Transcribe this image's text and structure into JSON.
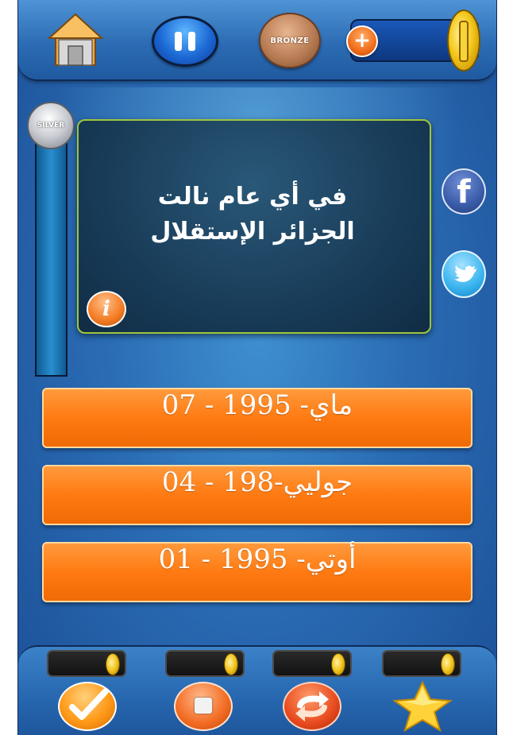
{
  "game": {
    "header": {
      "home_icon": "home-icon",
      "pause_icon": "pause-icon",
      "bronze_label": "BRONZE",
      "add_coins_symbol": "+",
      "coin_icon": "gold-coin-icon"
    },
    "progress": {
      "silver_label": "SILVER"
    },
    "question": {
      "text": "في أي عام نالت الجزائر الإستقلال",
      "info_symbol": "i"
    },
    "social": {
      "facebook_symbol": "f",
      "twitter_icon": "twitter-bird-icon"
    },
    "answers": [
      {
        "label": "ماي- 1995 - 07"
      },
      {
        "label": "جوليي-198 - 04"
      },
      {
        "label": "أوتي- 1995 - 01"
      }
    ],
    "powerups": [
      {
        "icon": "checkmark-icon"
      },
      {
        "icon": "stop-square-icon"
      },
      {
        "icon": "swap-arrows-icon"
      },
      {
        "icon": "star-icon"
      }
    ],
    "colors": {
      "background": "#2a6cb4",
      "answer": "#ff7a12",
      "board": "#173a56",
      "board_border": "#9fc63a"
    }
  }
}
